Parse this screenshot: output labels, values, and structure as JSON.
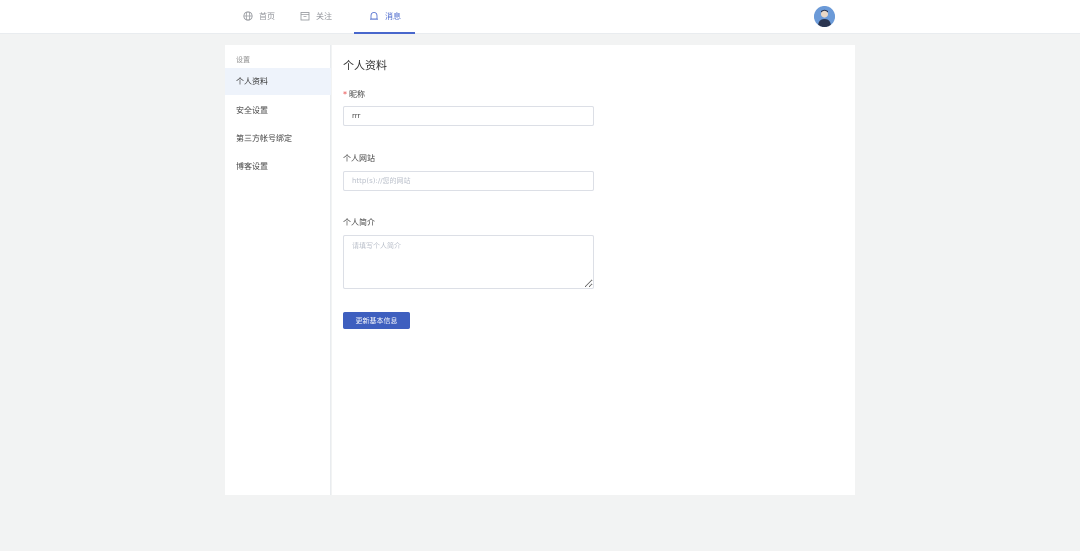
{
  "nav": {
    "items": [
      {
        "label": "首页",
        "icon": "globe-icon"
      },
      {
        "label": "关注",
        "icon": "calendar-icon"
      },
      {
        "label": "消息",
        "icon": "bell-icon"
      }
    ],
    "active_color": "#4867cc"
  },
  "sidebar": {
    "title": "设置",
    "items": [
      {
        "label": "个人资料"
      },
      {
        "label": "安全设置"
      },
      {
        "label": "第三方帐号绑定"
      },
      {
        "label": "博客设置"
      }
    ]
  },
  "main": {
    "title": "个人资料",
    "nickname": {
      "required_mark": "*",
      "label": "昵称",
      "value": "rrr"
    },
    "website": {
      "label": "个人网站",
      "placeholder": "http(s)://您的网站",
      "value": ""
    },
    "bio": {
      "label": "个人简介",
      "placeholder": "请填写个人简介",
      "value": ""
    },
    "submit_label": "更新基本信息",
    "accent": "#3e5fbf"
  }
}
